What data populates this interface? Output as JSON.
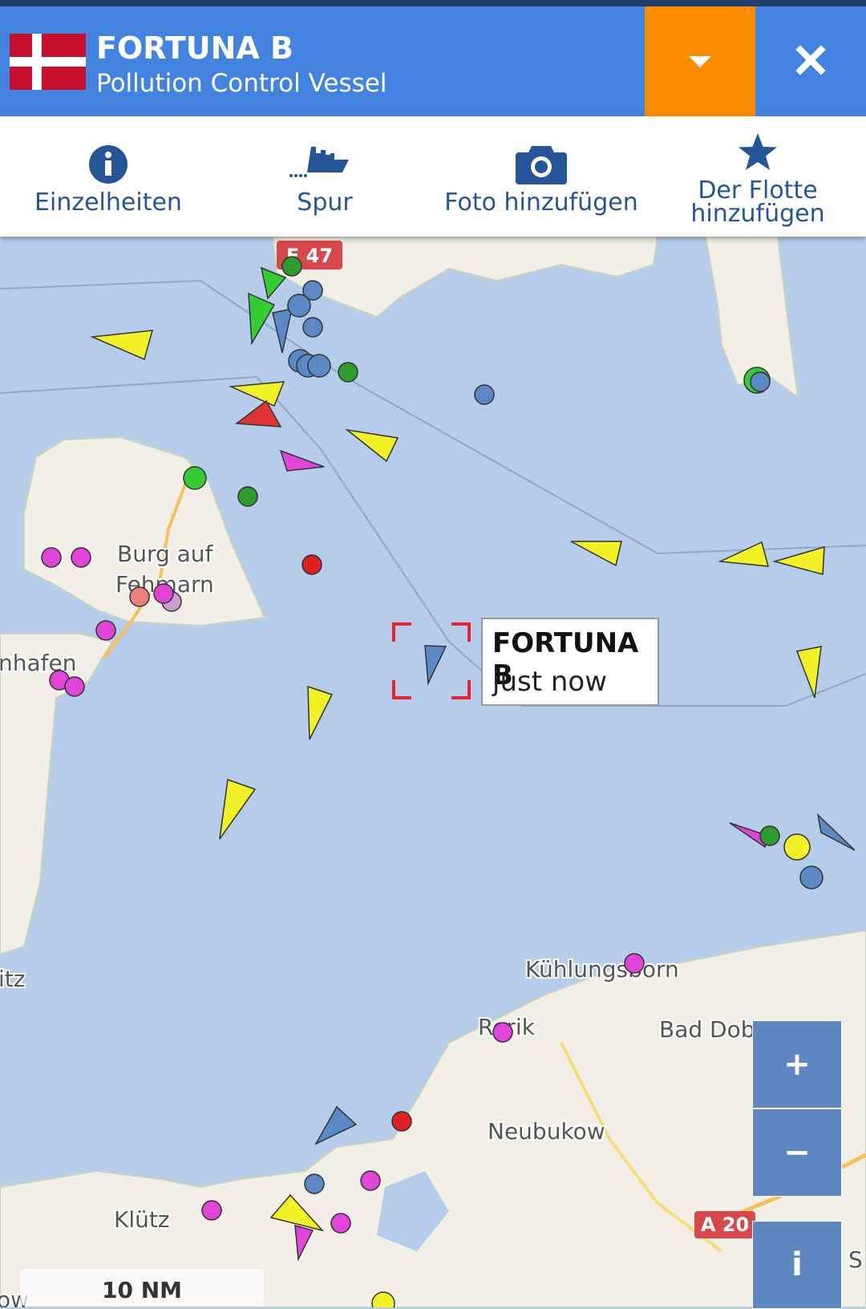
{
  "header": {
    "vessel_name": "FORTUNA B",
    "vessel_type": "Pollution Control Vessel",
    "flag": "denmark-flag",
    "accent_color": "#4283df",
    "dropdown_color": "#fb8c00"
  },
  "toolbar": {
    "details_label": "Einzelheiten",
    "track_label": "Spur",
    "add_photo_label": "Foto hinzufügen",
    "add_fleet_line1": "Der Flotte",
    "add_fleet_line2": "hinzufügen"
  },
  "map": {
    "road_label": "E 47",
    "highway_label": "A 20",
    "places": {
      "burg_line1": "Burg auf",
      "burg_line2": "Fehmarn",
      "heiligenhafen": "nhafen",
      "neustadt": "itz",
      "kuehlungsborn": "Kühlungsborn",
      "rerik": "Rerik",
      "bad_doberan": "Bad Doberan",
      "neubukow": "Neubukow",
      "kluetz": "Klütz",
      "edge_bottom_left": "ow",
      "edge_bottom_right": "S"
    },
    "selected_vessel": {
      "name": "FORTUNA B",
      "time": "just now"
    },
    "zoom_in": "+",
    "zoom_out": "−",
    "info": "i",
    "scale": "10 NM"
  }
}
